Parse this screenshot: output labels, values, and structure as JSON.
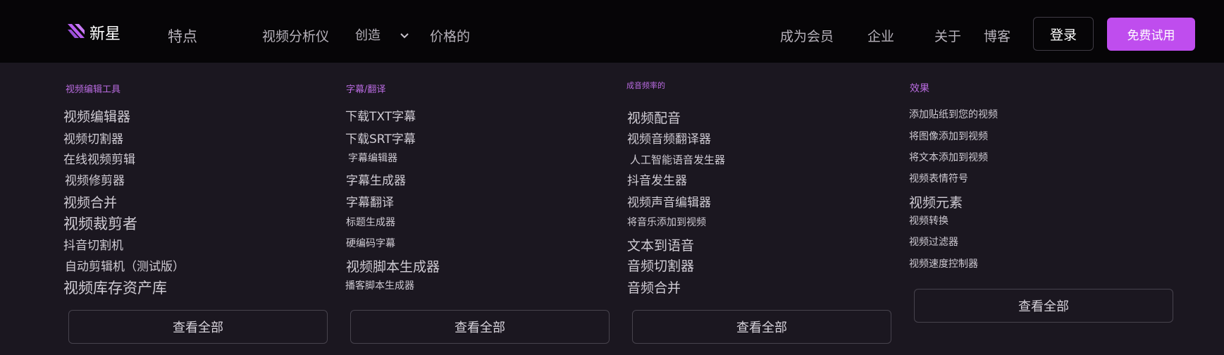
{
  "brand": {
    "name": "新星",
    "logo_icon": "slash-stripes-logo-icon",
    "accent": "#bf4dee"
  },
  "nav": {
    "features": "特点",
    "video_analyzer": "视频分析仪",
    "create": "创造",
    "pricing": "价格的",
    "become_member": "成为会员",
    "enterprise": "企业",
    "about": "关于",
    "blog": "博客",
    "login": "登录",
    "free_trial": "免费试用"
  },
  "menu": {
    "columns": [
      {
        "heading": "视频编辑工具",
        "items": [
          "视频编辑器",
          "视频切割器",
          "在线视频剪辑",
          "视频修剪器",
          "视频合并",
          "视频裁剪者",
          "抖音切割机",
          "自动剪辑机（测试版）",
          "视频库存资产库"
        ],
        "view_all": "查看全部"
      },
      {
        "heading": "字幕/翻译",
        "items": [
          "下载TXT字幕",
          "下载SRT字幕",
          "字幕编辑器",
          "字幕生成器",
          "字幕翻译",
          "标题生成器",
          "硬编码字幕",
          "视频脚本生成器",
          "播客脚本生成器"
        ],
        "view_all": "查看全部"
      },
      {
        "heading": "成音频率的",
        "items": [
          "视频配音",
          "视频音频翻译器",
          "人工智能语音发生器",
          "抖音发生器",
          "视频声音编辑器",
          "将音乐添加到视频",
          "文本到语音",
          "音频切割器",
          "音频合并"
        ],
        "view_all": "查看全部"
      },
      {
        "heading": "效果",
        "items": [
          "添加贴纸到您的视频",
          "将图像添加到视频",
          "将文本添加到视频",
          "视频表情符号",
          "视频元素",
          "视频转换",
          "视频过滤器",
          "视频速度控制器"
        ],
        "view_all": "查看全部"
      }
    ]
  }
}
